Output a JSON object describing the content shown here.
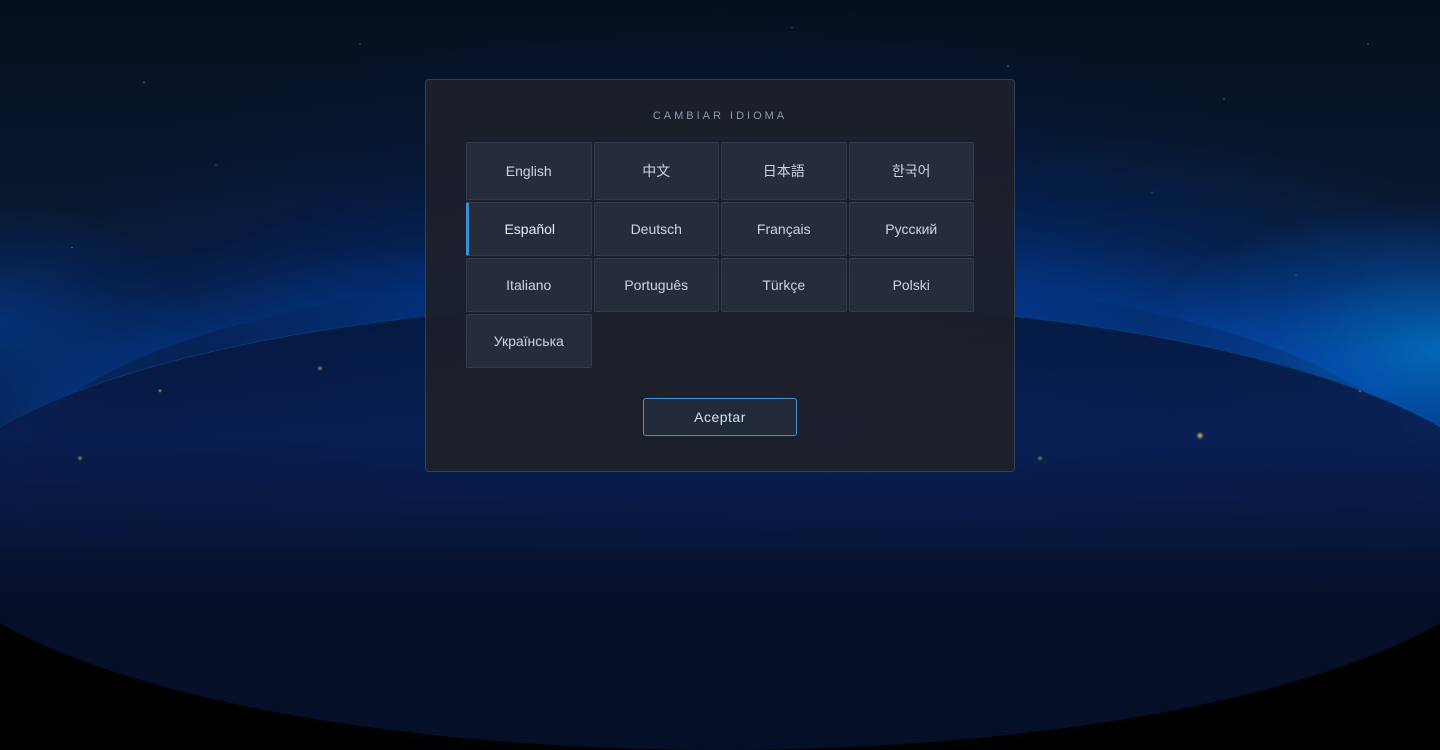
{
  "background": {
    "description": "Space Earth background"
  },
  "modal": {
    "title": "CAMBIAR IDIOMA",
    "accept_label": "Aceptar",
    "languages": [
      {
        "id": "english",
        "label": "English",
        "selected": false
      },
      {
        "id": "chinese",
        "label": "中文",
        "selected": false
      },
      {
        "id": "japanese",
        "label": "日本語",
        "selected": false
      },
      {
        "id": "korean",
        "label": "한국어",
        "selected": false
      },
      {
        "id": "spanish",
        "label": "Español",
        "selected": true
      },
      {
        "id": "german",
        "label": "Deutsch",
        "selected": false
      },
      {
        "id": "french",
        "label": "Français",
        "selected": false
      },
      {
        "id": "russian",
        "label": "Русский",
        "selected": false
      },
      {
        "id": "italian",
        "label": "Italiano",
        "selected": false
      },
      {
        "id": "portuguese",
        "label": "Português",
        "selected": false
      },
      {
        "id": "turkish",
        "label": "Türkçe",
        "selected": false
      },
      {
        "id": "polish",
        "label": "Polski",
        "selected": false
      },
      {
        "id": "ukrainian",
        "label": "Українська",
        "selected": false
      }
    ]
  }
}
